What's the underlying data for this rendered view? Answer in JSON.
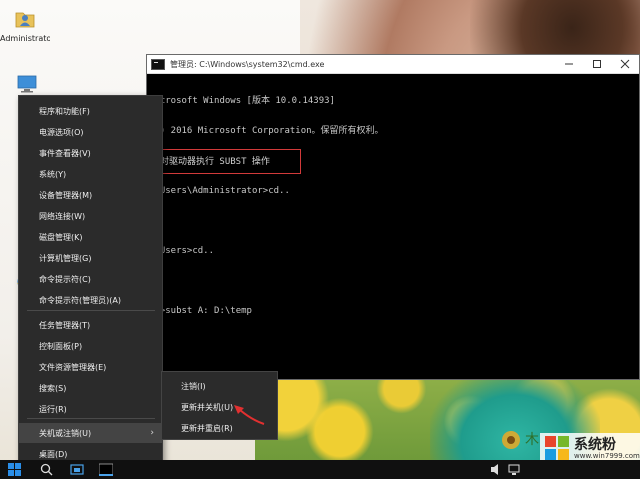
{
  "desktop": {
    "icons": [
      {
        "label": "Administrato...",
        "icon": "user-folder-icon"
      },
      {
        "label": "",
        "icon": "this-pc-icon"
      },
      {
        "label": "",
        "icon": "network-icon"
      },
      {
        "label": "",
        "icon": "control-panel-icon"
      },
      {
        "label": "",
        "icon": "internet-explorer-icon"
      }
    ]
  },
  "cmd": {
    "title": "管理员: C:\\Windows\\system32\\cmd.exe",
    "lines": [
      "Microsoft Windows [版本 10.0.14393]",
      "(c) 2016 Microsoft Corporation。保留所有权利。",
      "",
      ":\\Users\\Administrator>cd..",
      "",
      ":\\Users>cd..",
      "",
      ":\\>subst A: D:\\temp",
      "",
      "",
      "",
      ":\\>"
    ],
    "note": "逐对驱动器执行 SUBST 操作"
  },
  "winx_menu": {
    "items": [
      {
        "label": "程序和功能(F)"
      },
      {
        "label": "电源选项(O)"
      },
      {
        "label": "事件查看器(V)"
      },
      {
        "label": "系统(Y)"
      },
      {
        "label": "设备管理器(M)"
      },
      {
        "label": "网络连接(W)"
      },
      {
        "label": "磁盘管理(K)"
      },
      {
        "label": "计算机管理(G)"
      },
      {
        "label": "命令提示符(C)"
      },
      {
        "label": "命令提示符(管理员)(A)"
      },
      {
        "label": "任务管理器(T)"
      },
      {
        "label": "控制面板(P)"
      },
      {
        "label": "文件资源管理器(E)"
      },
      {
        "label": "搜索(S)"
      },
      {
        "label": "运行(R)"
      },
      {
        "label": "关机或注销(U)"
      },
      {
        "label": "桌面(D)"
      }
    ]
  },
  "shutdown_submenu": {
    "items": [
      {
        "label": "注销(I)"
      },
      {
        "label": "更新并关机(U)"
      },
      {
        "label": "更新并重启(R)"
      }
    ]
  },
  "taskbar": {
    "icons": [
      "windows-start-icon",
      "search-icon",
      "task-view-icon",
      "cmd-icon"
    ]
  },
  "watermark": {
    "name": "系统粉",
    "url": "www.win7999.com"
  },
  "colors": {
    "menu_bg": "#2b2b2b",
    "menu_hot": "#444444",
    "highlight_box": "#d23a3a",
    "arrow": "#e23030"
  }
}
